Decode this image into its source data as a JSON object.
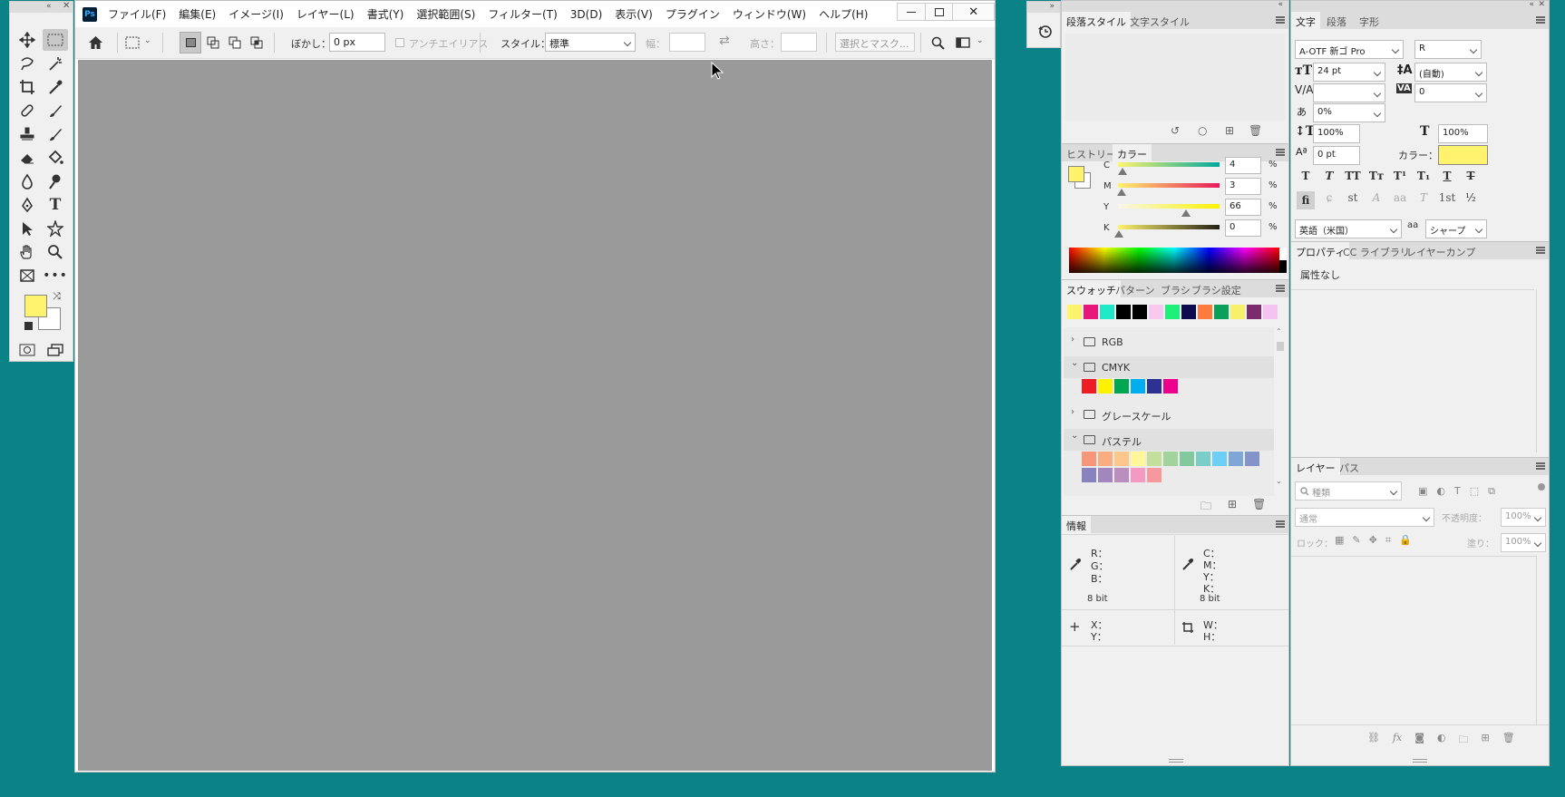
{
  "app_icon": "Ps",
  "menu": [
    "ファイル(F)",
    "編集(E)",
    "イメージ(I)",
    "レイヤー(L)",
    "書式(Y)",
    "選択範囲(S)",
    "フィルター(T)",
    "3D(D)",
    "表示(V)",
    "プラグイン",
    "ウィンドウ(W)",
    "ヘルプ(H)"
  ],
  "options": {
    "feather_label": "ぼかし：",
    "feather_value": "0 px",
    "antialias": "アンチエイリアス",
    "style_label": "スタイル：",
    "style_value": "標準",
    "width_label": "幅：",
    "height_label": "高さ：",
    "select_mask": "選択とマスク..."
  },
  "para_panel": {
    "tabs": [
      "段落スタイル",
      "文字スタイル"
    ]
  },
  "color_panel": {
    "tabs": [
      "ヒストリー",
      "カラー"
    ],
    "sliders": [
      {
        "label": "C",
        "value": "4",
        "pct": 4
      },
      {
        "label": "M",
        "value": "3",
        "pct": 3
      },
      {
        "label": "Y",
        "value": "66",
        "pct": 66
      },
      {
        "label": "K",
        "value": "0",
        "pct": 0
      }
    ],
    "unit": "%",
    "fg_color": "#fff36e"
  },
  "swatches_panel": {
    "tabs": [
      "スウォッチ",
      "パターン",
      "ブラシ",
      "ブラシ設定"
    ],
    "recent": [
      "#fff36e",
      "#e8157a",
      "#1ee8c8",
      "#000000",
      "#000000",
      "#f7c9ef",
      "#1ef07a",
      "#0b0b4d",
      "#ff7a3d",
      "#0aa05a",
      "#f7f06b",
      "#7a2b6e",
      "#f5c2f2"
    ],
    "groups": [
      {
        "name": "RGB",
        "open": false,
        "colors": []
      },
      {
        "name": "CMYK",
        "open": true,
        "colors": [
          "#ee1c25",
          "#fff200",
          "#00a650",
          "#00aeef",
          "#2e3192",
          "#ec008c"
        ]
      },
      {
        "name": "グレースケール",
        "open": false,
        "colors": []
      },
      {
        "name": "パステル",
        "open": true,
        "colors": [
          "#f7977a",
          "#f9ad81",
          "#fdc68a",
          "#fff79a",
          "#c4df9b",
          "#a2d39c",
          "#82ca9d",
          "#7bcdc8",
          "#6ecff6",
          "#7ea7d8",
          "#8493ca",
          "#8882be",
          "#a187be",
          "#bc8dbf",
          "#f49ac2",
          "#f6989d"
        ]
      }
    ]
  },
  "info_panel": {
    "tab": "情報",
    "rgb": [
      "R：",
      "G：",
      "B："
    ],
    "cmyk": [
      "C：",
      "M：",
      "Y：",
      "K："
    ],
    "bits_left": "8 bit",
    "bits_right": "8 bit",
    "xy": [
      "X：",
      "Y："
    ],
    "wh": [
      "W：",
      "H："
    ]
  },
  "char_panel": {
    "tabs": [
      "文字",
      "段落",
      "字形"
    ],
    "font_family": "A-OTF 新ゴ Pro",
    "font_style": "R",
    "font_size": "24 pt",
    "leading": "(自動)",
    "kerning": "",
    "tracking": "0",
    "tsume": "0%",
    "vscale": "100%",
    "hscale": "100%",
    "baseline": "0 pt",
    "color_label": "カラー：",
    "color": "#fff36e",
    "language": "英語（米国）",
    "aa_label": "aa",
    "antialias": "シャープ"
  },
  "props_panel": {
    "tabs": [
      "プロパティ",
      "CC ライブラリ",
      "レイヤーカンプ"
    ],
    "content": "属性なし"
  },
  "layers_panel": {
    "tabs": [
      "レイヤー",
      "パス"
    ],
    "filter": "種類",
    "blend": "通常",
    "opacity_label": "不透明度：",
    "opacity": "100%",
    "lock_label": "ロック：",
    "fill_label": "塗り：",
    "fill": "100%"
  }
}
